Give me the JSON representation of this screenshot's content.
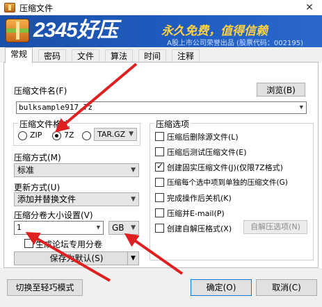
{
  "window": {
    "title": "压缩文件",
    "close": "✕"
  },
  "banner": {
    "brand": "2345好压",
    "slogan": "永久免费，值得信赖",
    "subtitle": "A股上市公司荣誉出品 (股票代码：002195)"
  },
  "tabs": [
    {
      "label": "常规",
      "active": true
    },
    {
      "label": "密码",
      "active": false
    },
    {
      "label": "文件",
      "active": false
    },
    {
      "label": "算法",
      "active": false
    },
    {
      "label": "时间",
      "active": false
    },
    {
      "label": "注释",
      "active": false
    }
  ],
  "filename": {
    "label": "压缩文件名(F)",
    "value": "bulksample917.7z",
    "browse": "浏览(B)"
  },
  "format": {
    "title": "压缩文件格式",
    "zip": "ZIP",
    "sevenz": "7Z",
    "tar_value": "TAR.GZ",
    "selected": "7Z"
  },
  "method": {
    "label": "压缩方式(M)",
    "value": "标准"
  },
  "update": {
    "label": "更新方式(U)",
    "value": "添加并替换文件"
  },
  "split": {
    "label": "压缩分卷大小设置(V)",
    "value": "1",
    "unit": "GB",
    "forum_label": "生成论坛专用分卷",
    "forum_checked": false
  },
  "save_default": "保存为默认(S)",
  "options": {
    "title": "压缩选项",
    "items": [
      {
        "label": "压缩后删除源文件(L)",
        "checked": false
      },
      {
        "label": "压缩后测试压缩文件(E)",
        "checked": false
      },
      {
        "label": "创建固实压缩文件(J)(仅限7Z格式)",
        "checked": true
      },
      {
        "label": "压缩每个选中项到单独的压缩文件(G)",
        "checked": false
      },
      {
        "label": "完成操作后关机(K)",
        "checked": false
      },
      {
        "label": "压缩并E-mail(P)",
        "checked": false
      },
      {
        "label": "创建自解压格式(X)",
        "checked": false
      }
    ],
    "sfx_button": "自解压选项(N)"
  },
  "bottom": {
    "simple_mode": "切换至轻巧模式",
    "ok": "确定(O)",
    "cancel": "取消(C)"
  },
  "colors": {
    "banner": "#1f5cc0",
    "slogan": "#ffd23f",
    "arrow": "#e02020"
  }
}
